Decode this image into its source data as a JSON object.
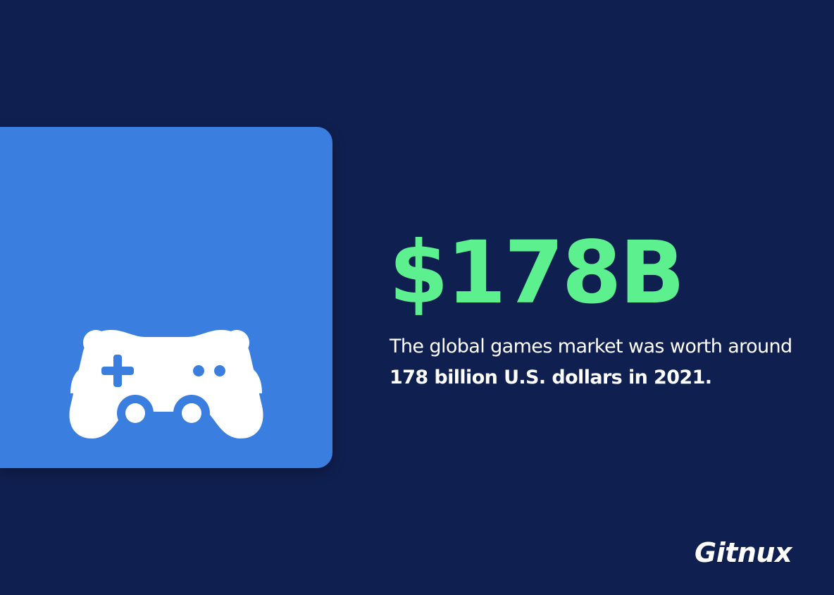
{
  "colors": {
    "background": "#0f1f4f",
    "card": "#3a7fe0",
    "accent": "#5cf08f",
    "text": "#ffffff",
    "icon": "#ffffff"
  },
  "icon": {
    "name": "multiplayer-gamepad-icon"
  },
  "stat": {
    "value": "$178B",
    "description_plain": "The global games market was worth around ",
    "description_bold": "178 billion U.S. dollars in 2021."
  },
  "brand": {
    "logo_text": "Gitnux"
  }
}
